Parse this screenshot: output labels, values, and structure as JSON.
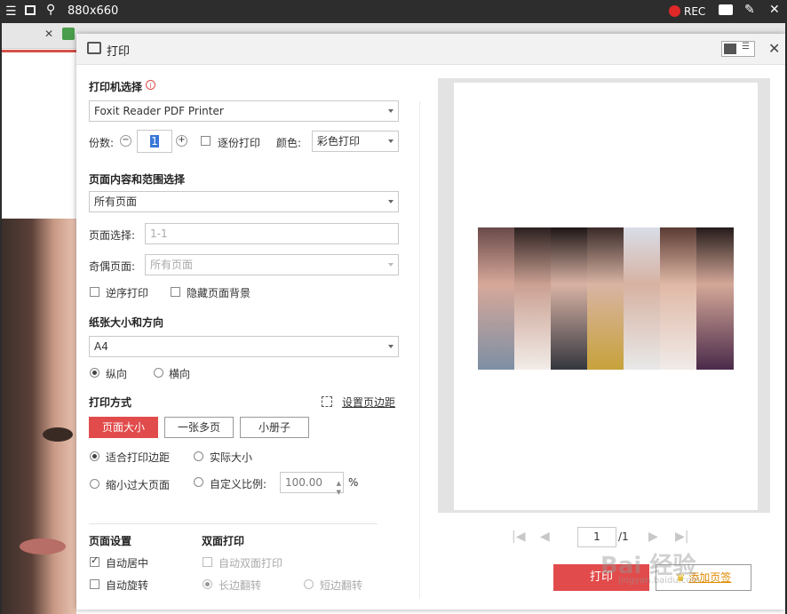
{
  "recorder": {
    "size_label": "880x660",
    "rec_label": "REC"
  },
  "dialog": {
    "title": "打印",
    "printer_section": "打印机选择",
    "printer_value": "Foxit Reader PDF Printer",
    "copies_label": "份数:",
    "copies_value": "1",
    "collate_label": "逐份打印",
    "color_label": "颜色:",
    "color_value": "彩色打印",
    "range_section": "页面内容和范围选择",
    "range_value": "所有页面",
    "page_select_label": "页面选择:",
    "page_select_placeholder": "1-1",
    "odd_even_label": "奇偶页面:",
    "odd_even_value": "所有页面",
    "reverse_label": "逆序打印",
    "hide_bg_label": "隐藏页面背景",
    "paper_section": "纸张大小和方向",
    "paper_value": "A4",
    "portrait_label": "纵向",
    "landscape_label": "横向",
    "print_mode_section": "打印方式",
    "set_margin_link": "设置页边距",
    "mode_buttons": [
      "页面大小",
      "一张多页",
      "小册子"
    ],
    "fit_margin_label": "适合打印边距",
    "actual_size_label": "实际大小",
    "shrink_label": "缩小过大页面",
    "custom_scale_label": "自定义比例:",
    "custom_scale_value": "100.00",
    "percent": "%",
    "page_settings_section": "页面设置",
    "auto_center_label": "自动居中",
    "auto_rotate_label": "自动旋转",
    "duplex_section": "双面打印",
    "auto_duplex_label": "自动双面打印",
    "long_edge_label": "长边翻转",
    "short_edge_label": "短边翻转",
    "page_input": "1",
    "page_total": "/1",
    "print_button": "打印",
    "add_printer_link": "添加页签"
  },
  "watermark": {
    "text": "Bai 经验",
    "sub": "jingyan.baidu.com"
  },
  "colors": {
    "accent": "#e24b4b",
    "link": "#333333"
  }
}
